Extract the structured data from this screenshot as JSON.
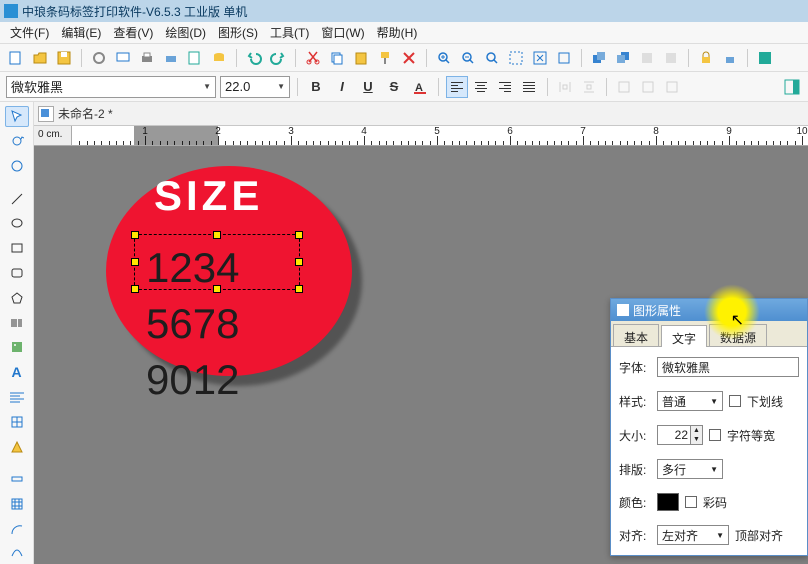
{
  "title": "中琅条码标签打印软件-V6.5.3 工业版 单机",
  "menu": [
    "文件(F)",
    "编辑(E)",
    "查看(V)",
    "绘图(D)",
    "图形(S)",
    "工具(T)",
    "窗口(W)",
    "帮助(H)"
  ],
  "font_combo": "微软雅黑",
  "size_combo": "22.0",
  "doc_tab": "未命名-2 *",
  "ruler_unit": "0 cm.",
  "ruler_marks": [
    "1",
    "2",
    "3",
    "4",
    "5",
    "6",
    "7",
    "8",
    "9",
    "10"
  ],
  "canvas": {
    "size_label": "SIZE",
    "text_lines": [
      "1234",
      "5678",
      "9012"
    ]
  },
  "panel": {
    "title": "图形属性",
    "tabs": [
      "基本",
      "文字",
      "数据源"
    ],
    "active_tab": 1,
    "font_label": "字体:",
    "font_value": "微软雅黑",
    "style_label": "样式:",
    "style_value": "普通",
    "underline_chk": "下划线",
    "size_label": "大小:",
    "size_value": "22",
    "mono_chk": "字符等宽",
    "layout_label": "排版:",
    "layout_value": "多行",
    "color_label": "颜色:",
    "colorcode_chk": "彩码",
    "align_label": "对齐:",
    "align_value": "左对齐",
    "topalign_label": "顶部对齐"
  }
}
